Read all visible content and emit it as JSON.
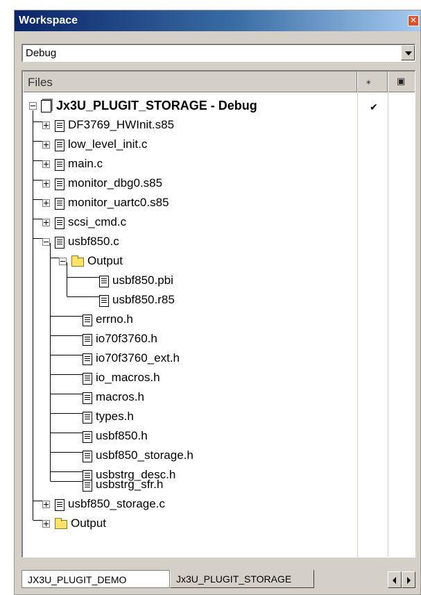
{
  "window": {
    "title": "Workspace",
    "close_icon": "close-icon"
  },
  "config_select": {
    "value": "Debug"
  },
  "files_panel": {
    "header": {
      "files_label": "Files",
      "col2_icon": "make-status-icon",
      "col3_icon": "options-icon"
    },
    "project": {
      "label": "Jx3U_PLUGIT_STORAGE - Debug",
      "checked": "✔"
    },
    "items": [
      {
        "label": "DF3769_HWInit.s85"
      },
      {
        "label": "low_level_init.c"
      },
      {
        "label": "main.c"
      },
      {
        "label": "monitor_dbg0.s85"
      },
      {
        "label": "monitor_uartc0.s85"
      },
      {
        "label": "scsi_cmd.c"
      },
      {
        "label": "usbf850.c"
      },
      {
        "label": "Output"
      },
      {
        "label": "usbf850.pbi"
      },
      {
        "label": "usbf850.r85"
      },
      {
        "label": "errno.h"
      },
      {
        "label": "io70f3760.h"
      },
      {
        "label": "io70f3760_ext.h"
      },
      {
        "label": "io_macros.h"
      },
      {
        "label": "macros.h"
      },
      {
        "label": "types.h"
      },
      {
        "label": "usbf850.h"
      },
      {
        "label": "usbf850_storage.h"
      },
      {
        "label": "usbstrg_desc.h"
      },
      {
        "label": "usbstrg_sfr.h"
      },
      {
        "label": "usbf850_storage.c"
      },
      {
        "label": "Output"
      }
    ]
  },
  "tabs": [
    {
      "label": "JX3U_PLUGIT_DEMO"
    },
    {
      "label": "Jx3U_PLUGIT_STORAGE"
    }
  ]
}
